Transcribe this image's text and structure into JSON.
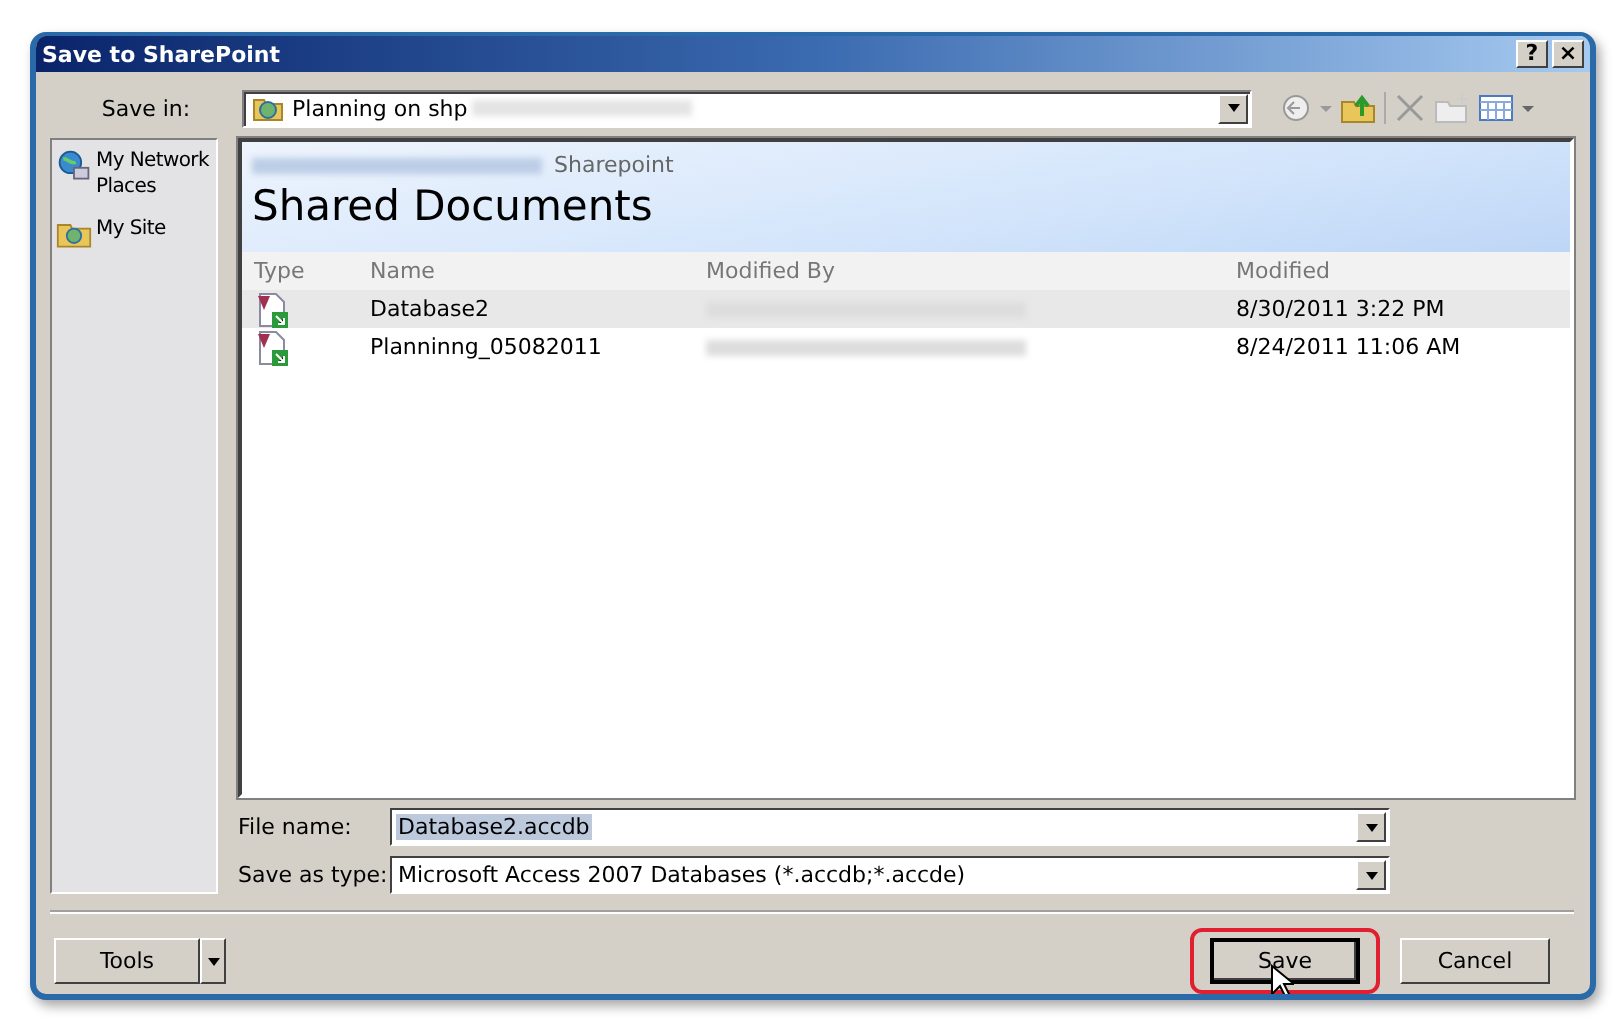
{
  "window": {
    "title": "Save to SharePoint",
    "title_buttons": [
      "?",
      "×"
    ]
  },
  "save_in": {
    "label": "Save in:",
    "value": "Planning on shp"
  },
  "places": [
    {
      "label": "My Network Places",
      "kind": "network"
    },
    {
      "label": "My Site",
      "kind": "site"
    }
  ],
  "banner": {
    "site": "Sharepoint",
    "title": "Shared Documents"
  },
  "table": {
    "columns": [
      "Type",
      "Name",
      "Modified By",
      "Modified"
    ],
    "rows": [
      {
        "name": "Database2",
        "modified": "8/30/2011 3:22 PM",
        "selected": true
      },
      {
        "name": "Planninng_05082011",
        "modified": "8/24/2011 11:06 AM",
        "selected": false
      }
    ]
  },
  "file_name": {
    "label": "File name:",
    "value": "Database2.accdb",
    "text_selected": true
  },
  "save_as_type": {
    "label": "Save as type:",
    "value": "Microsoft Access 2007 Databases (*.accdb;*.accde)"
  },
  "tools_button": "Tools",
  "buttons": [
    {
      "label": "Save",
      "default": true,
      "annotated": true
    },
    {
      "label": "Cancel",
      "default": false,
      "annotated": false
    }
  ]
}
